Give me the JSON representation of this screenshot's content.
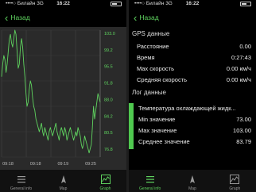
{
  "status": {
    "carrier": "Билайн",
    "network": "3G",
    "time": "16:22"
  },
  "nav": {
    "back_label": "Назад"
  },
  "gps": {
    "title": "GPS данные",
    "rows": [
      {
        "label": "Расстояние",
        "value": "0.00"
      },
      {
        "label": "Время",
        "value": "0:27:43"
      },
      {
        "label": "Max скорость",
        "value": "0.00 км/ч"
      },
      {
        "label": "Средняя скорость",
        "value": "0.00 км/ч"
      }
    ]
  },
  "log": {
    "title": "Лог данные",
    "sensor_name": "Температура охлаждающей жидк...",
    "rows": [
      {
        "label": "Min значение",
        "value": "73.00"
      },
      {
        "label": "Max значение",
        "value": "103.00"
      },
      {
        "label": "Среднее значение",
        "value": "83.79"
      }
    ],
    "accent_color": "#4fc94f"
  },
  "tabs": [
    {
      "label": "General info",
      "icon": "list-icon"
    },
    {
      "label": "Map",
      "icon": "map-icon"
    },
    {
      "label": "Graph",
      "icon": "graph-icon"
    }
  ],
  "active_tab": "Graph",
  "chart_data": {
    "type": "line",
    "title": "",
    "xlabel": "",
    "ylabel": "",
    "ylim": [
      73.0,
      103.0
    ],
    "yticks": [
      "103.0",
      "99.2",
      "95.5",
      "91.8",
      "88.0",
      "84.2",
      "80.5",
      "76.8"
    ],
    "xticks": [
      "09:18",
      "09:18",
      "09:19",
      "09:25"
    ],
    "color": "#5fd35f",
    "series": [
      {
        "values": [
          92,
          95,
          97,
          96,
          93,
          95,
          98,
          101,
          102,
          100,
          99,
          101,
          103,
          102,
          98,
          94,
          95,
          99,
          101,
          99,
          95,
          92,
          88,
          85,
          86,
          89,
          91,
          90,
          87,
          85,
          84,
          82,
          81,
          80,
          79,
          80,
          81,
          79,
          78,
          80,
          79,
          78,
          77,
          79,
          80,
          79,
          78,
          79,
          80,
          81,
          79,
          78,
          77,
          79,
          80,
          79,
          78,
          80,
          79,
          77,
          78,
          79,
          80,
          79,
          78,
          77,
          78,
          79,
          78,
          80,
          79,
          78,
          76,
          75,
          76,
          78,
          77,
          76,
          75,
          74,
          75,
          76,
          80,
          85,
          82,
          84,
          86,
          88,
          87,
          86
        ]
      }
    ]
  }
}
